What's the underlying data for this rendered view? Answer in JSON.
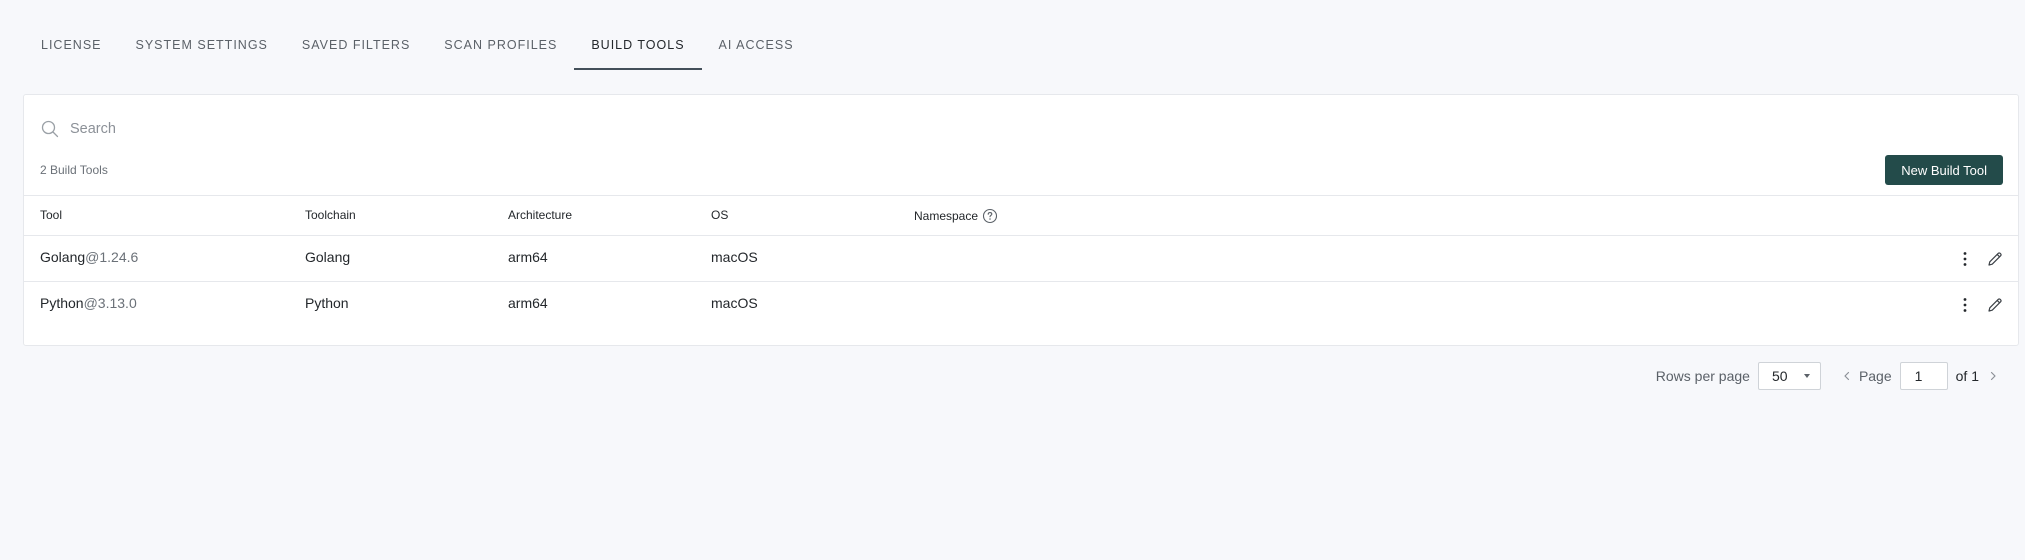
{
  "tabs": [
    {
      "label": "LICENSE"
    },
    {
      "label": "SYSTEM SETTINGS"
    },
    {
      "label": "SAVED FILTERS"
    },
    {
      "label": "SCAN PROFILES"
    },
    {
      "label": "BUILD TOOLS",
      "active": true
    },
    {
      "label": "AI ACCESS"
    }
  ],
  "search": {
    "placeholder": "Search",
    "value": ""
  },
  "summary": {
    "count_text": "2 Build Tools"
  },
  "actions": {
    "new_button_label": "New Build Tool"
  },
  "table": {
    "columns": [
      "Tool",
      "Toolchain",
      "Architecture",
      "OS",
      "Namespace"
    ],
    "rows": [
      {
        "tool_name": "Golang",
        "tool_version": "@1.24.6",
        "toolchain": "Golang",
        "architecture": "arm64",
        "os": "macOS",
        "namespace": ""
      },
      {
        "tool_name": "Python",
        "tool_version": "@3.13.0",
        "toolchain": "Python",
        "architecture": "arm64",
        "os": "macOS",
        "namespace": ""
      }
    ]
  },
  "pagination": {
    "rows_per_page_label": "Rows per page",
    "rows_per_page_value": "50",
    "page_label": "Page",
    "current_page": "1",
    "of_label": "of 1"
  },
  "colors": {
    "accent": "#234b4a",
    "background": "#f7f8fb",
    "border": "#e6e8ec"
  }
}
